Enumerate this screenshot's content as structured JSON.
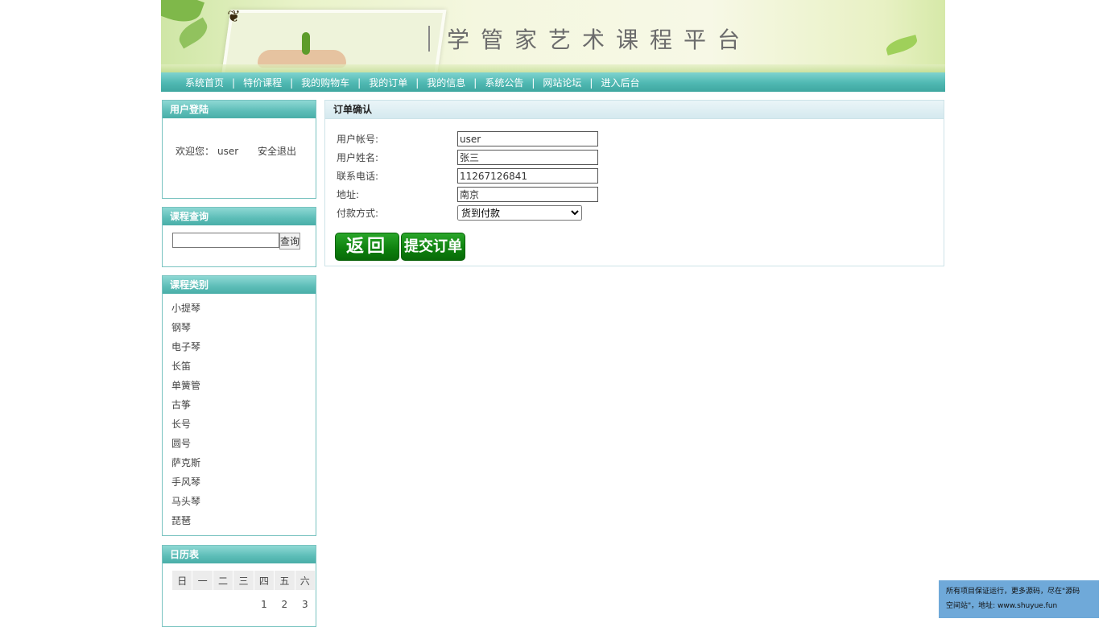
{
  "banner": {
    "title": "学管家艺术课程平台"
  },
  "nav": {
    "items": [
      "系统首页",
      "特价课程",
      "我的购物车",
      "我的订单",
      "我的信息",
      "系统公告",
      "网站论坛",
      "进入后台"
    ],
    "separator": "|"
  },
  "login": {
    "header": "用户登陆",
    "welcome_label": "欢迎您：",
    "username": "user",
    "logout": "安全退出"
  },
  "search": {
    "header": "课程查询",
    "input_value": "",
    "button": "查询"
  },
  "categories": {
    "header": "课程类别",
    "items": [
      "小提琴",
      "钢琴",
      "电子琴",
      "长笛",
      "单簧管",
      "古筝",
      "长号",
      "圆号",
      "萨克斯",
      "手风琴",
      "马头琴",
      "琵琶"
    ]
  },
  "calendar": {
    "header": "日历表",
    "weekdays": [
      "日",
      "一",
      "二",
      "三",
      "四",
      "五",
      "六"
    ],
    "first_row": [
      "",
      "",
      "",
      "",
      "1",
      "2",
      "3"
    ]
  },
  "order": {
    "header": "订单确认",
    "account_label": "用户帐号:",
    "account_value": "user",
    "name_label": "用户姓名:",
    "name_value": "张三",
    "phone_label": "联系电话:",
    "phone_value": "11267126841",
    "address_label": "地址:",
    "address_value": "南京",
    "payment_label": "付款方式:",
    "payment_value": "货到付款",
    "back_button": "返回",
    "submit_button": "提交订单"
  },
  "note": {
    "line1": "所有项目保证运行，更多源码，尽在\"源码",
    "line2": "空间站\"，地址: www.shuyue.fun"
  },
  "colors": {
    "nav": "#4fb8b2",
    "button_green": "#0d7f0d",
    "note_bg": "#6fa9d9"
  }
}
